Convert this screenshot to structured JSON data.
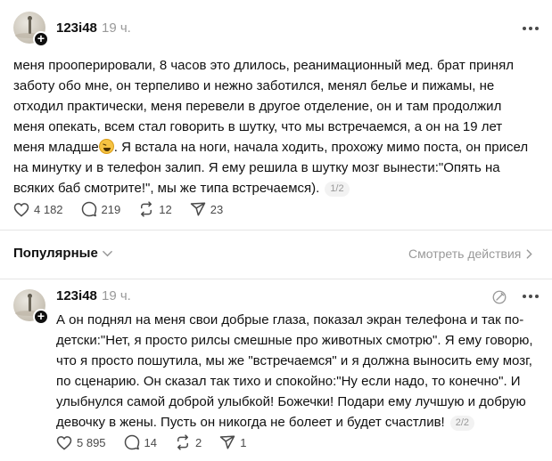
{
  "posts": [
    {
      "username": "123i48",
      "time": "19 ч.",
      "text_before_emoji": "меня прооперировали, 8 часов это длилось, реанимационный мед. брат принял заботу обо мне, он терпеливо и нежно заботился, менял белье и пижамы, не отходил практически, меня перевели в другое отделение, он и там продолжил меня опекать, всем стал говорить в шутку, что мы встречаемся, а он на 19 лет меня младше",
      "text_after_emoji": ". Я встала на ноги, начала ходить, прохожу мимо поста, он присел на минутку и в телефон залип. Я ему решила в шутку мозг вынести:\"Опять на всяких баб смотрите!\", мы же типа встречаемся).",
      "page": "1/2",
      "likes": "4 182",
      "comments": "219",
      "reposts": "12",
      "shares": "23"
    },
    {
      "username": "123i48",
      "time": "19 ч.",
      "text": "А он поднял на меня свои добрые глаза, показал экран телефона и так по-детски:\"Нет, я просто рилсы смешные про животных смотрю\". Я ему говорю, что я просто пошутила, мы же \"встречаемся\" и я должна выносить ему мозг, по сценарию. Он сказал так тихо и спокойно:\"Ну если надо, то конечно\". И улыбнулся самой доброй улыбкой! Божечки! Подари ему лучшую и добрую девочку в жены. Пусть он никогда не болеет и будет счастлив!",
      "page": "2/2",
      "likes": "5 895",
      "comments": "14",
      "reposts": "2",
      "shares": "1"
    }
  ],
  "sort": {
    "label": "Популярные"
  },
  "activity_link": "Смотреть действия",
  "icons": {
    "more": "more-horizontal-icon",
    "like": "heart-icon",
    "comment": "comment-icon",
    "repost": "repost-icon",
    "share": "send-icon",
    "edit": "edit-off-icon",
    "chevron_down": "chevron-down-icon",
    "chevron_right": "chevron-right-icon"
  },
  "colors": {
    "text": "#101010",
    "muted": "#999999",
    "divider": "#e5e5e5"
  }
}
